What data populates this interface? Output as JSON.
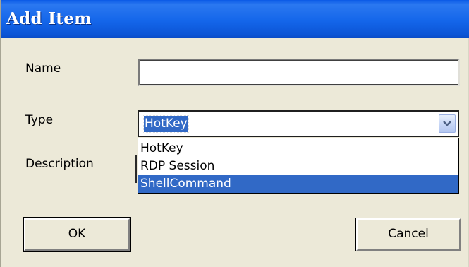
{
  "window": {
    "title": "Add Item"
  },
  "form": {
    "name_label": "Name",
    "name_value": "",
    "type_label": "Type",
    "type_selected": "HotKey",
    "description_label": "Description"
  },
  "dropdown": {
    "options": [
      {
        "label": "HotKey",
        "highlighted": false
      },
      {
        "label": "RDP Session",
        "highlighted": false
      },
      {
        "label": "ShellCommand",
        "highlighted": true
      }
    ]
  },
  "buttons": {
    "ok_label": "OK",
    "cancel_label": "Cancel"
  },
  "icons": {
    "dropdown_arrow": "chevron-down-icon"
  },
  "colors": {
    "title_bar": "#1466ea",
    "selection": "#3169c6",
    "dialog_background": "#ece9d8"
  }
}
